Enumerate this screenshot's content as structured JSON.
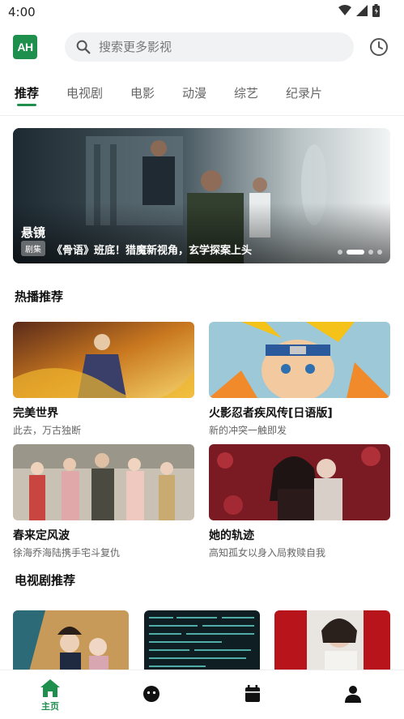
{
  "status_bar": {
    "time": "4:00"
  },
  "header": {
    "logo_text": "AH",
    "search_placeholder": "搜索更多影视",
    "accent_color": "#1f8f4e"
  },
  "tabs": [
    {
      "label": "推荐",
      "active": true
    },
    {
      "label": "电视剧",
      "active": false
    },
    {
      "label": "电影",
      "active": false
    },
    {
      "label": "动漫",
      "active": false
    },
    {
      "label": "综艺",
      "active": false
    },
    {
      "label": "纪录片",
      "active": false
    }
  ],
  "banner": {
    "title": "悬镜",
    "tag": "剧集",
    "subtitle": "《骨语》班底！猎魔新视角，玄学探案上头",
    "dots": 4,
    "active_dot": 2
  },
  "hot_section": {
    "title": "热播推荐",
    "items": [
      {
        "name": "完美世界",
        "desc": "此去，万古独断"
      },
      {
        "name": "火影忍者疾风传[日语版]",
        "desc": "新的冲突一触即发"
      },
      {
        "name": "春来定风波",
        "desc": "徐海乔海陆携手宅斗复仇"
      },
      {
        "name": "她的轨迹",
        "desc": "高知孤女以身入局救赎自我"
      }
    ]
  },
  "tv_section": {
    "title": "电视剧推荐"
  },
  "bottom_nav": {
    "items": [
      {
        "label": "主页",
        "icon": "home-icon",
        "active": true
      },
      {
        "label": "",
        "icon": "face-icon",
        "active": false
      },
      {
        "label": "",
        "icon": "calendar-icon",
        "active": false
      },
      {
        "label": "",
        "icon": "person-icon",
        "active": false
      }
    ]
  }
}
